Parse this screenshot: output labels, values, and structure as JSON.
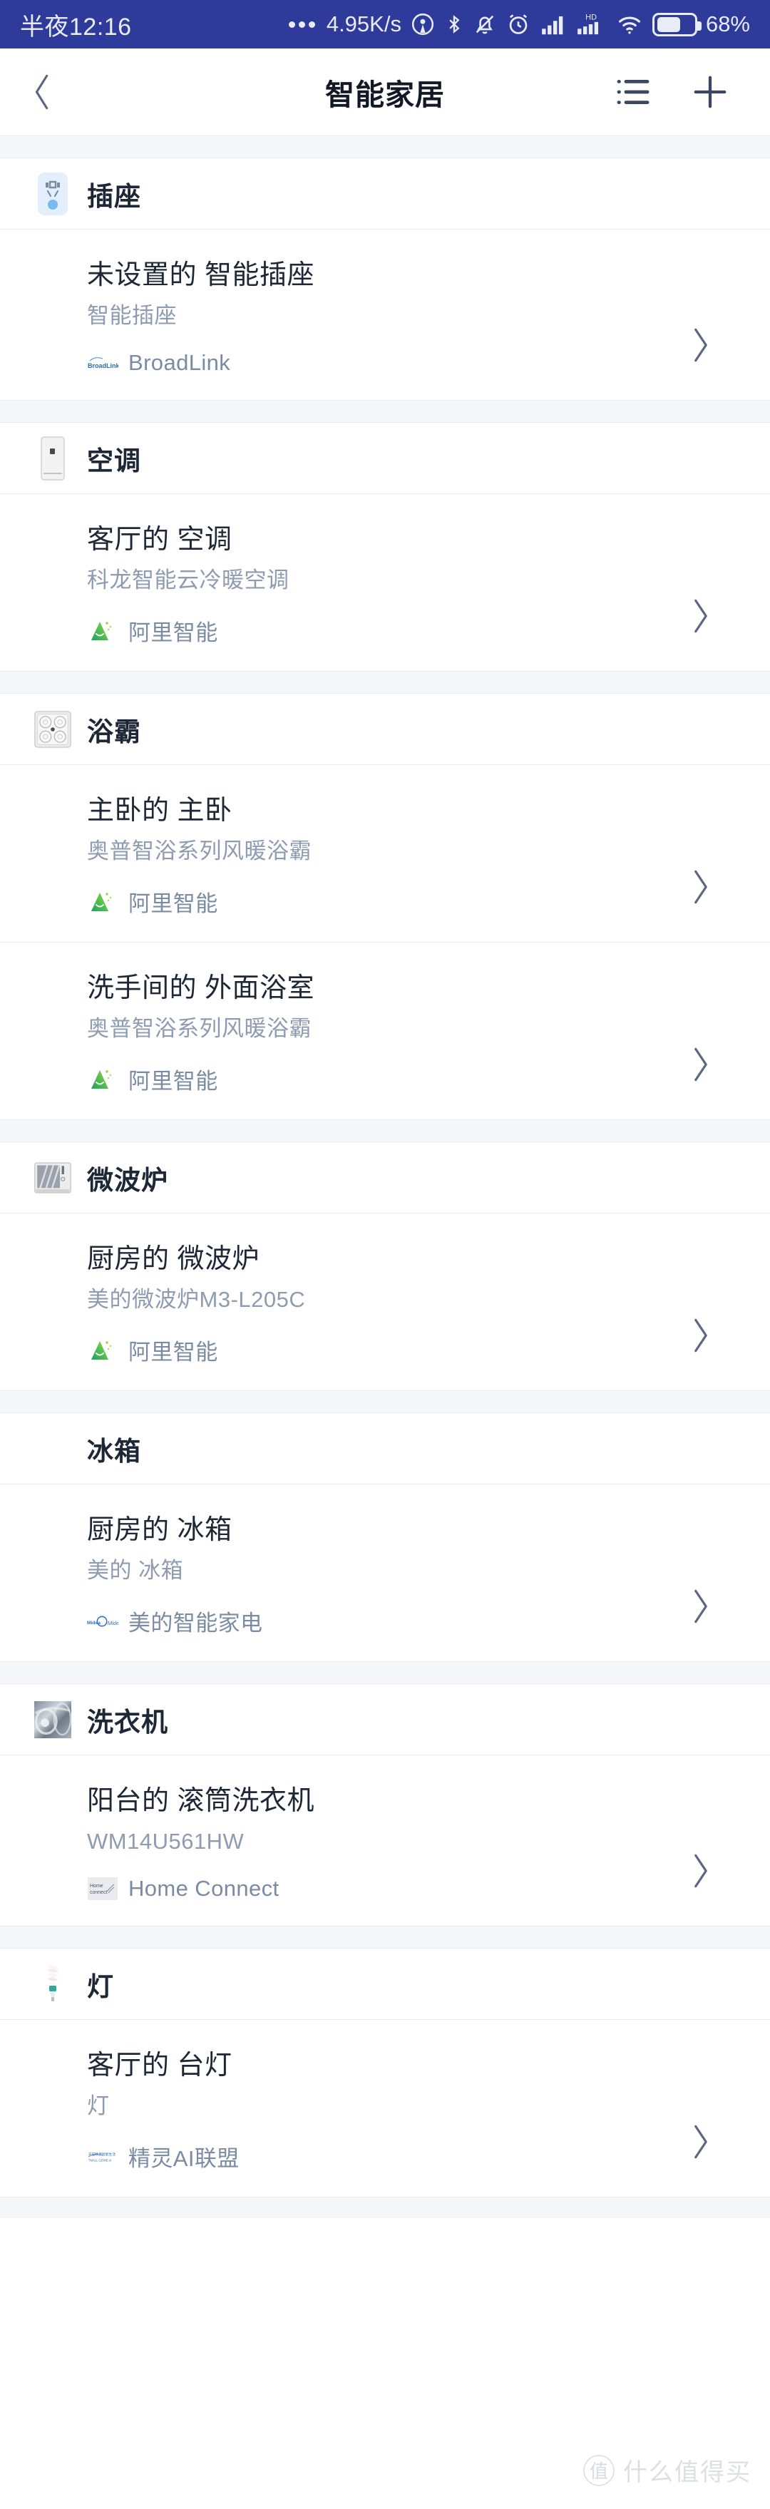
{
  "status_bar": {
    "time": "半夜12:16",
    "network_speed": "4.95K/s",
    "battery_percent": "68%",
    "hd_label": "HD",
    "icons": [
      "more-dots-icon",
      "location-icon",
      "bluetooth-icon",
      "mute-bell-icon",
      "alarm-clock-icon",
      "signal-bars-icon",
      "signal-bars-hd-icon",
      "wifi-icon",
      "battery-icon"
    ]
  },
  "nav": {
    "back_icon": "chevron-left-icon",
    "title": "智能家居",
    "list_icon": "list-view-icon",
    "add_icon": "plus-icon"
  },
  "sections": [
    {
      "label": "插座",
      "icon": "power-socket-icon",
      "has_icon": true,
      "devices": [
        {
          "name": "未设置的 智能插座",
          "model": "智能插座",
          "brand": "BroadLink",
          "brand_logo": "broadlink-logo",
          "chevron": "chevron-right-icon"
        }
      ]
    },
    {
      "label": "空调",
      "icon": "air-conditioner-icon",
      "has_icon": true,
      "devices": [
        {
          "name": "客厅的 空调",
          "model": "科龙智能云冷暖空调",
          "brand": "阿里智能",
          "brand_logo": "ali-smart-logo",
          "chevron": "chevron-right-icon"
        }
      ]
    },
    {
      "label": "浴霸",
      "icon": "bath-heater-icon",
      "has_icon": true,
      "devices": [
        {
          "name": "主卧的 主卧",
          "model": "奥普智浴系列风暖浴霸",
          "brand": "阿里智能",
          "brand_logo": "ali-smart-logo",
          "chevron": "chevron-right-icon"
        },
        {
          "name": "洗手间的 外面浴室",
          "model": "奥普智浴系列风暖浴霸",
          "brand": "阿里智能",
          "brand_logo": "ali-smart-logo",
          "chevron": "chevron-right-icon"
        }
      ]
    },
    {
      "label": "微波炉",
      "icon": "microwave-icon",
      "has_icon": true,
      "devices": [
        {
          "name": "厨房的 微波炉",
          "model": "美的微波炉M3-L205C",
          "brand": "阿里智能",
          "brand_logo": "ali-smart-logo",
          "chevron": "chevron-right-icon"
        }
      ]
    },
    {
      "label": "冰箱",
      "icon": "",
      "has_icon": false,
      "devices": [
        {
          "name": "厨房的 冰箱",
          "model": "美的 冰箱",
          "brand": "美的智能家电",
          "brand_logo": "midea-logo",
          "chevron": "chevron-right-icon"
        }
      ]
    },
    {
      "label": "洗衣机",
      "icon": "washing-machine-icon",
      "has_icon": true,
      "devices": [
        {
          "name": "阳台的 滚筒洗衣机",
          "model": "WM14U561HW",
          "brand": "Home Connect",
          "brand_logo": "home-connect-logo",
          "chevron": "chevron-right-icon"
        }
      ]
    },
    {
      "label": "灯",
      "icon": "light-bulb-icon",
      "has_icon": true,
      "devices": [
        {
          "name": "客厅的 台灯",
          "model": "灯",
          "brand": "精灵AI联盟",
          "brand_logo": "genie-ai-logo",
          "chevron": "chevron-right-icon"
        }
      ]
    }
  ],
  "watermark": {
    "mark": "值",
    "text": "什么值得买"
  },
  "colors": {
    "status_bar_bg": "#2e3b9a",
    "primary_text": "#1d2736",
    "secondary_text": "#8e9bb0",
    "brand_text": "#7c8ba4",
    "divider": "#ececee",
    "section_gap_bg": "#f4f6f9"
  }
}
